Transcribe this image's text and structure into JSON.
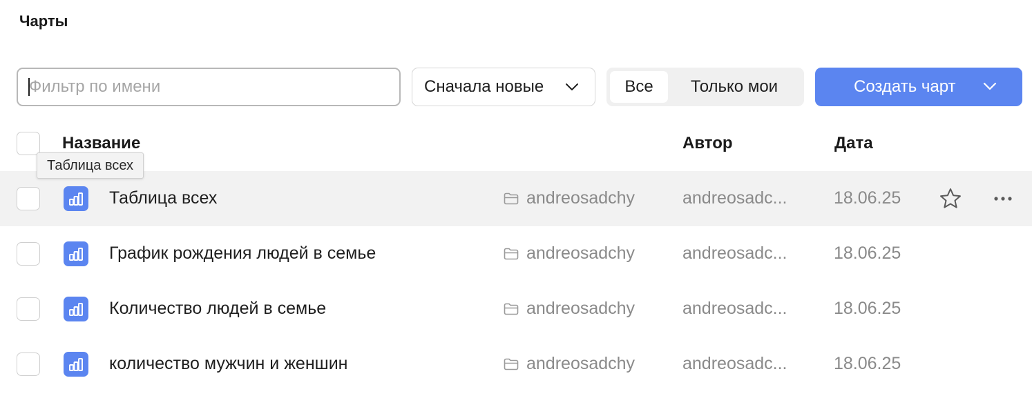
{
  "page": {
    "title": "Чарты"
  },
  "toolbar": {
    "filter_placeholder": "Фильтр по имени",
    "filter_value": "",
    "sort_selected": "Сначала новые",
    "segments": [
      {
        "label": "Все",
        "active": true
      },
      {
        "label": "Только мои",
        "active": false
      }
    ],
    "create_label": "Создать чарт"
  },
  "table": {
    "columns": {
      "name": "Название",
      "author": "Автор",
      "date": "Дата"
    },
    "rows": [
      {
        "name": "Таблица всех",
        "folder": "andreosadchy",
        "author": "andreosadc...",
        "date": "18.06.25",
        "hovered": true
      },
      {
        "name": "График рождения людей в семье",
        "folder": "andreosadchy",
        "author": "andreosadc...",
        "date": "18.06.25",
        "hovered": false
      },
      {
        "name": "Количество людей в семье",
        "folder": "andreosadchy",
        "author": "andreosadc...",
        "date": "18.06.25",
        "hovered": false
      },
      {
        "name": "количество мужчин и женшин",
        "folder": "andreosadchy",
        "author": "andreosadc...",
        "date": "18.06.25",
        "hovered": false
      }
    ]
  },
  "tooltip": {
    "text": "Таблица всех"
  },
  "colors": {
    "accent": "#5b85f0",
    "hover_row": "#f2f2f2",
    "muted_text": "#8a8a8a"
  },
  "icons": {
    "chart": "chart-bars-icon",
    "folder": "folder-icon",
    "star": "star-icon",
    "more": "more-dots-icon",
    "chevron": "chevron-down-icon"
  }
}
